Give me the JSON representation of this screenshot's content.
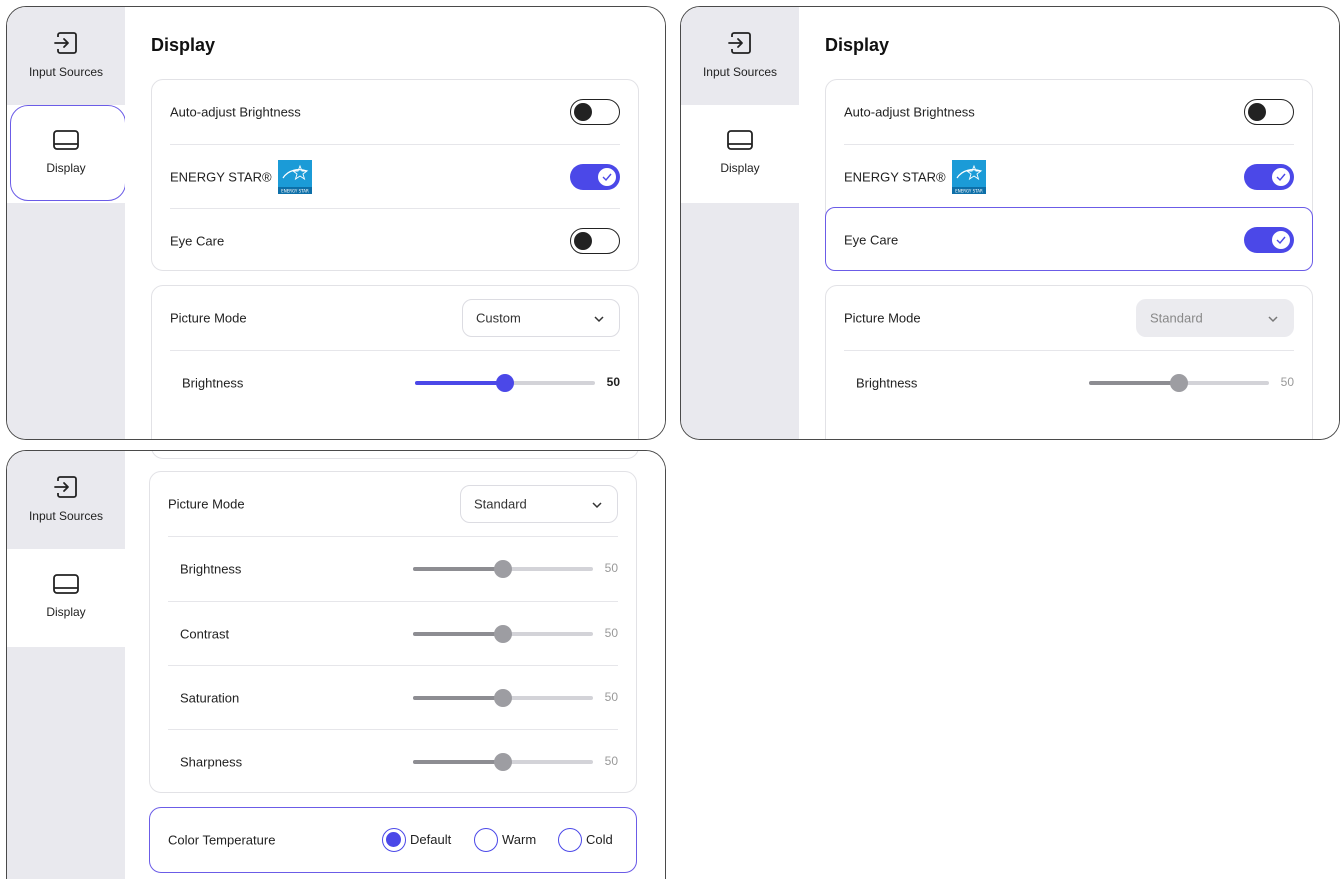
{
  "sidebar": {
    "input_sources_label": "Input Sources",
    "display_label": "Display"
  },
  "page_title": "Display",
  "settings": {
    "auto_adjust_brightness": {
      "label": "Auto-adjust Brightness"
    },
    "energy_star": {
      "label": "ENERGY STAR®",
      "logo_text": "ENERGY STAR"
    },
    "eye_care": {
      "label": "Eye Care"
    },
    "picture_mode": {
      "label": "Picture Mode"
    },
    "brightness": {
      "label": "Brightness",
      "value": "50"
    },
    "contrast": {
      "label": "Contrast",
      "value": "50"
    },
    "saturation": {
      "label": "Saturation",
      "value": "50"
    },
    "sharpness": {
      "label": "Sharpness",
      "value": "50"
    },
    "color_temperature": {
      "label": "Color Temperature",
      "options": [
        "Default",
        "Warm",
        "Cold"
      ],
      "selected": "Default"
    }
  },
  "panel1": {
    "auto_adjust_on": false,
    "energy_star_on": true,
    "eye_care_on": false,
    "picture_mode_value": "Custom",
    "brightness_fraction": 0.5
  },
  "panel2": {
    "auto_adjust_on": false,
    "energy_star_on": true,
    "eye_care_on": true,
    "picture_mode_value": "Standard",
    "brightness_fraction": 0.5
  },
  "panel3": {
    "picture_mode_value": "Standard",
    "brightness_fraction": 0.5,
    "contrast_fraction": 0.5,
    "saturation_fraction": 0.5,
    "sharpness_fraction": 0.5
  },
  "colors": {
    "accent": "#4b48e8",
    "focus_ring": "#6b5ce7",
    "sidebar_bg": "#e9e9ee",
    "energy_star_blue": "#1b9bd7"
  },
  "icons": {
    "input_sources": "input-sources-icon",
    "display": "display-icon",
    "chevron": "chevron-down-icon",
    "check": "check-icon"
  }
}
